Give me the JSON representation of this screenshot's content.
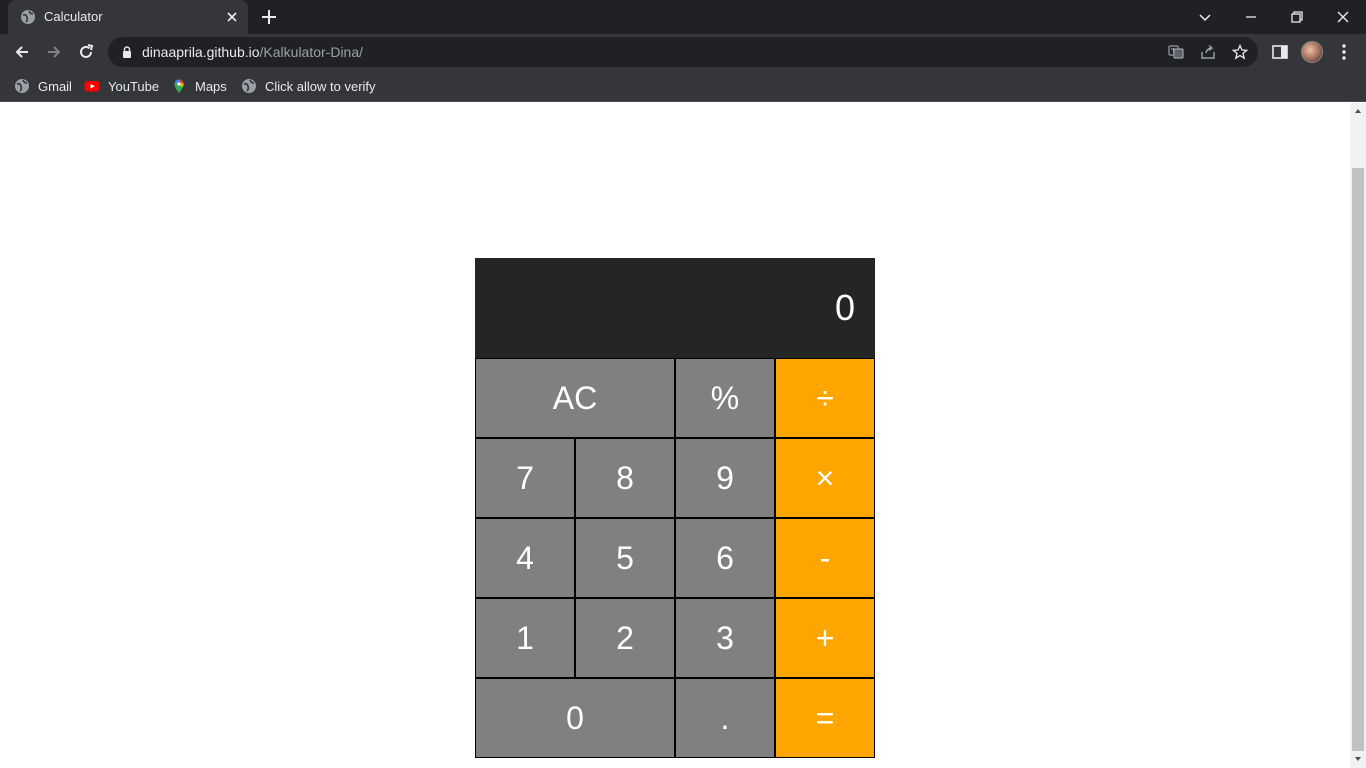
{
  "browser": {
    "tab": {
      "title": "Calculator"
    },
    "address": {
      "host": "dinaaprila.github.io",
      "path": "/Kalkulator-Dina/"
    },
    "bookmarks": [
      {
        "label": "Gmail",
        "icon": "globe-icon"
      },
      {
        "label": "YouTube",
        "icon": "youtube-icon"
      },
      {
        "label": "Maps",
        "icon": "maps-pin-icon"
      },
      {
        "label": "Click allow to verify",
        "icon": "globe-icon"
      }
    ]
  },
  "calculator": {
    "display": "0",
    "keys": {
      "clear": "AC",
      "percent": "%",
      "divide": "÷",
      "seven": "7",
      "eight": "8",
      "nine": "9",
      "multiply": "×",
      "four": "4",
      "five": "5",
      "six": "6",
      "subtract": "-",
      "one": "1",
      "two": "2",
      "three": "3",
      "add": "+",
      "zero": "0",
      "decimal": ".",
      "equals": "="
    },
    "colors": {
      "display_bg": "#252525",
      "key_bg": "#808080",
      "operator_bg": "#ffa500",
      "text": "#ffffff"
    }
  }
}
